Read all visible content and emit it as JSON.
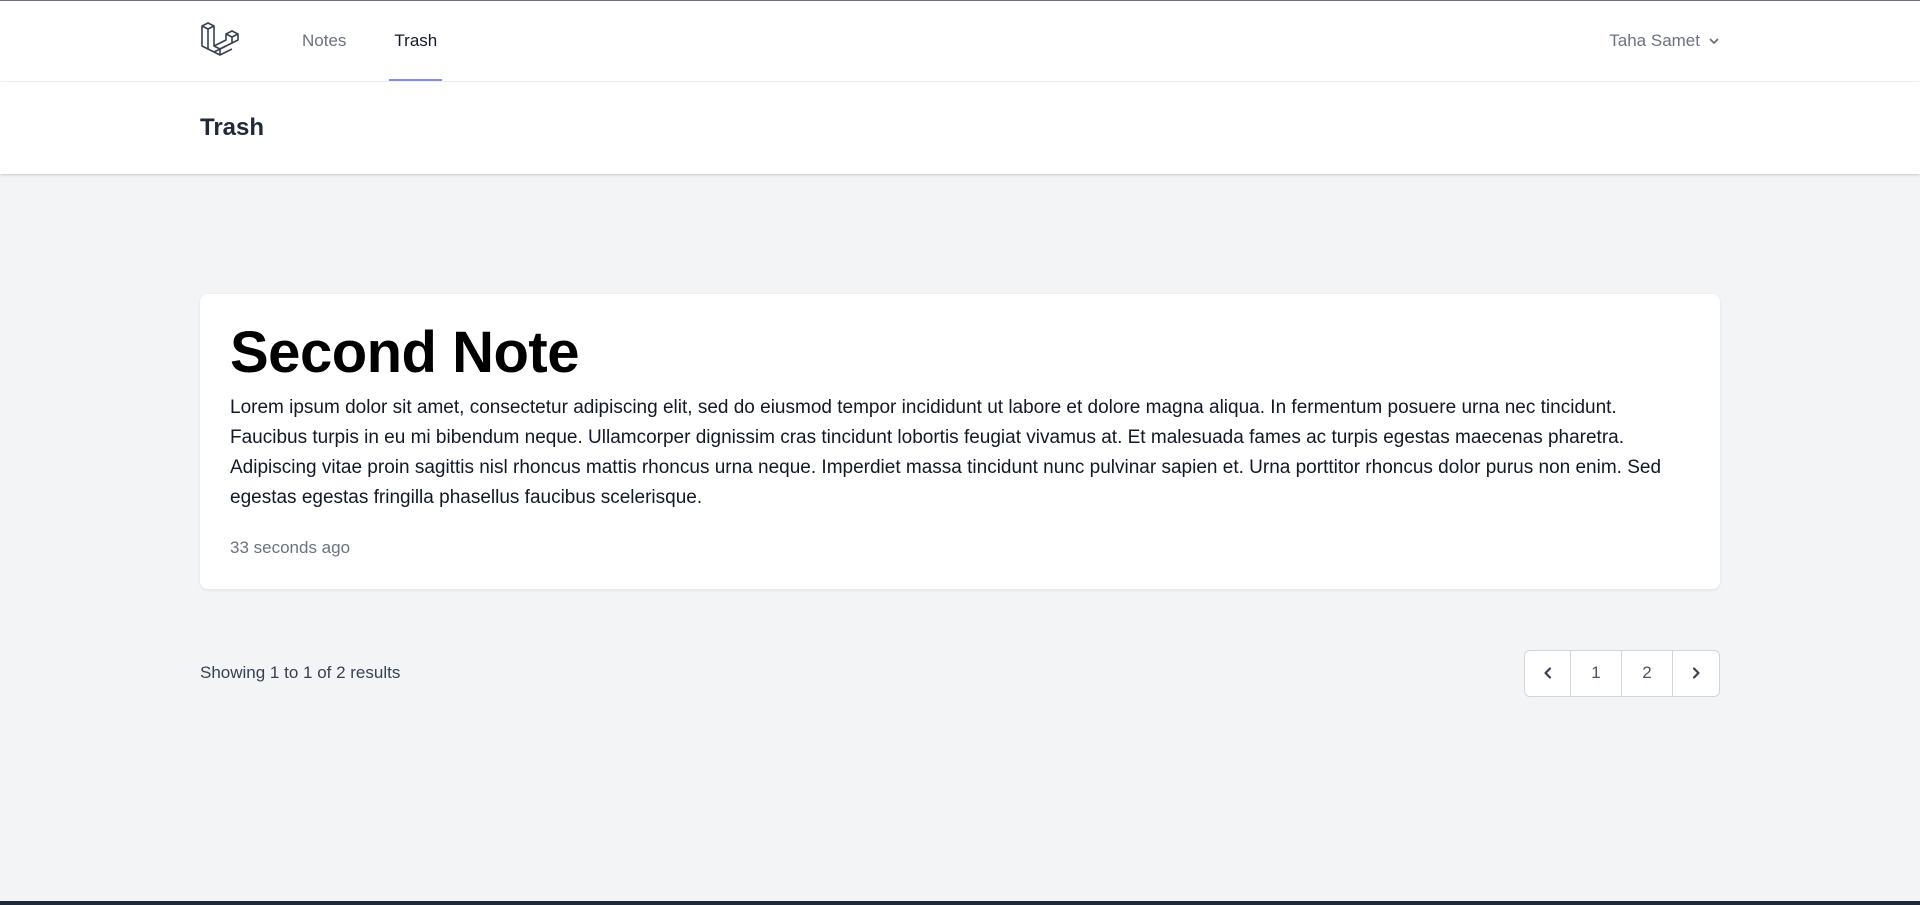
{
  "nav": {
    "links": [
      {
        "label": "Notes",
        "active": false
      },
      {
        "label": "Trash",
        "active": true
      }
    ],
    "user": {
      "name": "Taha Samet"
    }
  },
  "header": {
    "title": "Trash"
  },
  "note": {
    "title": "Second Note",
    "body": "Lorem ipsum dolor sit amet, consectetur adipiscing elit, sed do eiusmod tempor incididunt ut labore et dolore magna aliqua. In fermentum posuere urna nec tincidunt. Faucibus turpis in eu mi bibendum neque. Ullamcorper dignissim cras tincidunt lobortis feugiat vivamus at. Et malesuada fames ac turpis egestas maecenas pharetra. Adipiscing vitae proin sagittis nisl rhoncus mattis rhoncus urna neque. Imperdiet massa tincidunt nunc pulvinar sapien et. Urna porttitor rhoncus dolor purus non enim. Sed egestas egestas fringilla phasellus faucibus scelerisque.",
    "time": "33 seconds ago"
  },
  "pagination": {
    "summary": "Showing 1 to 1 of 2 results",
    "pages": [
      "1",
      "2"
    ],
    "current": "1"
  },
  "colors": {
    "accent": "#818cf8",
    "background": "#f3f4f6"
  }
}
